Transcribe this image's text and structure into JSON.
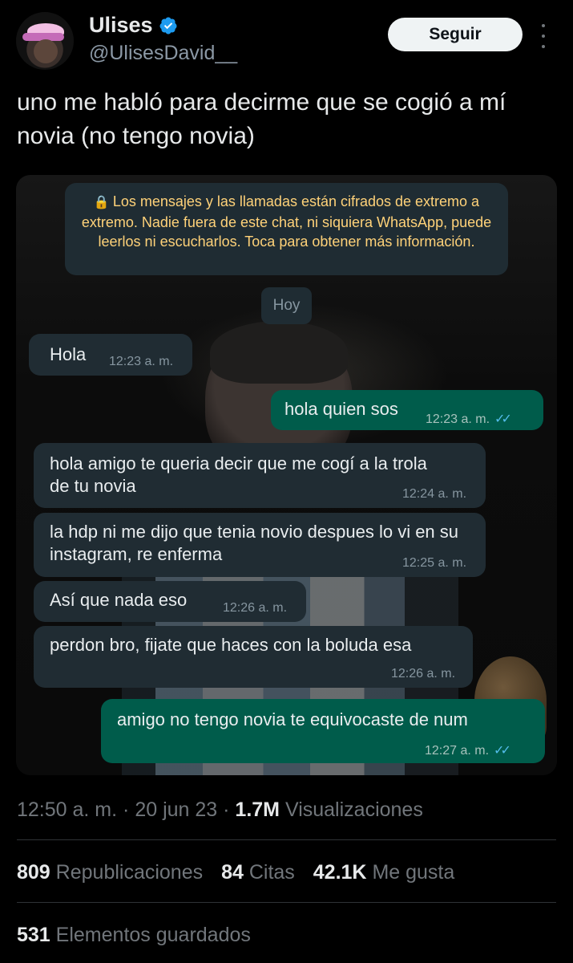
{
  "user": {
    "display_name": "Ulises",
    "handle": "@UlisesDavid__",
    "follow_label": "Seguir",
    "verified": true
  },
  "tweet": {
    "text": "uno me habló para decirme que se cogió a mí novia (no tengo novia)"
  },
  "screenshot": {
    "encryption_notice": "Los mensajes y las llamadas están cifrados de extremo a extremo. Nadie fuera de este chat, ni siquiera WhatsApp, puede leerlos ni escucharlos. Toca para obtener más información.",
    "date_chip": "Hoy",
    "messages": [
      {
        "direction": "in",
        "text": "Hola",
        "time": "12:23 a. m."
      },
      {
        "direction": "out",
        "text": "hola quien sos",
        "time": "12:23 a. m."
      },
      {
        "direction": "in",
        "text": "hola amigo te queria decir que me cogí a la trola de tu novia",
        "time": "12:24 a. m."
      },
      {
        "direction": "in",
        "text": "la hdp ni me dijo que tenia novio despues lo vi en su instagram, re enferma",
        "time": "12:25 a. m."
      },
      {
        "direction": "in",
        "text": "Así que nada eso",
        "time": "12:26 a. m."
      },
      {
        "direction": "in",
        "text": "perdon bro, fijate que haces con la boluda esa",
        "time": "12:26 a. m."
      },
      {
        "direction": "out",
        "text": "amigo no tengo novia te equivocaste de num",
        "time": "12:27 a. m."
      }
    ]
  },
  "meta": {
    "time": "12:50 a. m.",
    "separator": "·",
    "date": "20 jun 23",
    "views_count": "1.7M",
    "views_label": "Visualizaciones"
  },
  "stats": {
    "reposts_count": "809",
    "reposts_label": "Republicaciones",
    "quotes_count": "84",
    "quotes_label": "Citas",
    "likes_count": "42.1K",
    "likes_label": "Me gusta",
    "bookmarks_count": "531",
    "bookmarks_label": "Elementos guardados"
  },
  "colors": {
    "background": "#000000",
    "accent_blue": "#1d9bf0",
    "whatsapp_incoming": "#202c33",
    "whatsapp_outgoing": "#005c4b",
    "notice_text": "#ffd279"
  }
}
